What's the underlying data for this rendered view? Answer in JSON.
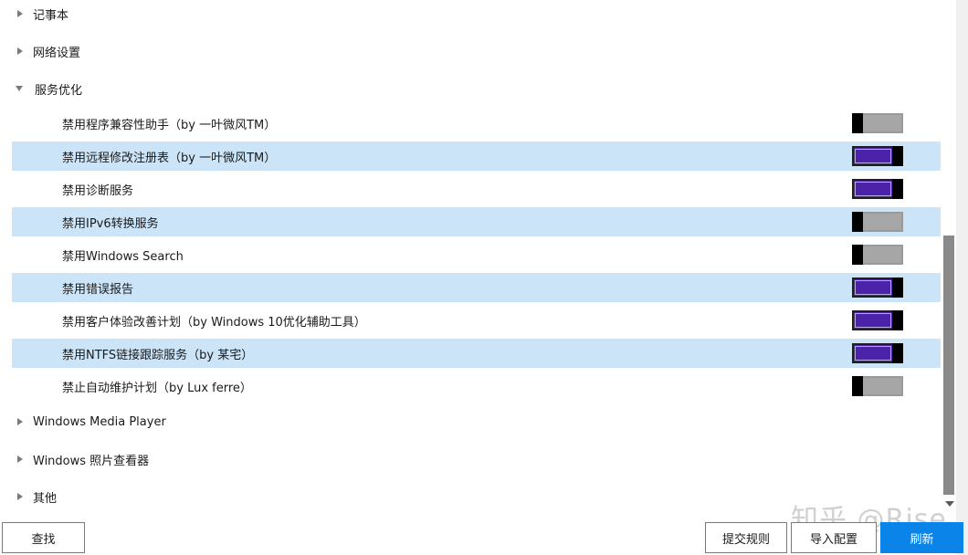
{
  "groups_top": [
    {
      "label": "记事本",
      "expanded": false
    },
    {
      "label": "网络设置",
      "expanded": false
    },
    {
      "label": "服务优化",
      "expanded": true
    }
  ],
  "service_items": [
    {
      "label": "禁用程序兼容性助手（by 一叶微风TM）",
      "on": false
    },
    {
      "label": "禁用远程修改注册表（by 一叶微风TM）",
      "on": true
    },
    {
      "label": "禁用诊断服务",
      "on": true
    },
    {
      "label": "禁用IPv6转换服务",
      "on": false
    },
    {
      "label": "禁用Windows Search",
      "on": false
    },
    {
      "label": "禁用错误报告",
      "on": true
    },
    {
      "label": "禁用客户体验改善计划（by Windows 10优化辅助工具）",
      "on": true
    },
    {
      "label": "禁用NTFS链接跟踪服务（by 某宅）",
      "on": true
    },
    {
      "label": "禁止自动维护计划（by Lux ferre）",
      "on": false
    }
  ],
  "groups_bottom": [
    {
      "label": "Windows Media Player",
      "expanded": false
    },
    {
      "label": "Windows 照片查看器",
      "expanded": false
    },
    {
      "label": "其他",
      "expanded": false
    }
  ],
  "buttons": {
    "find": "查找",
    "submit_rules": "提交规则",
    "import_config": "导入配置",
    "refresh": "刷新"
  },
  "watermark": "知乎 @Rise",
  "colors": {
    "toggle_on": "#4b23a8",
    "toggle_off": "#a6a6a6",
    "row_highlight": "#cce4f7",
    "primary_button": "#0a84e8"
  }
}
